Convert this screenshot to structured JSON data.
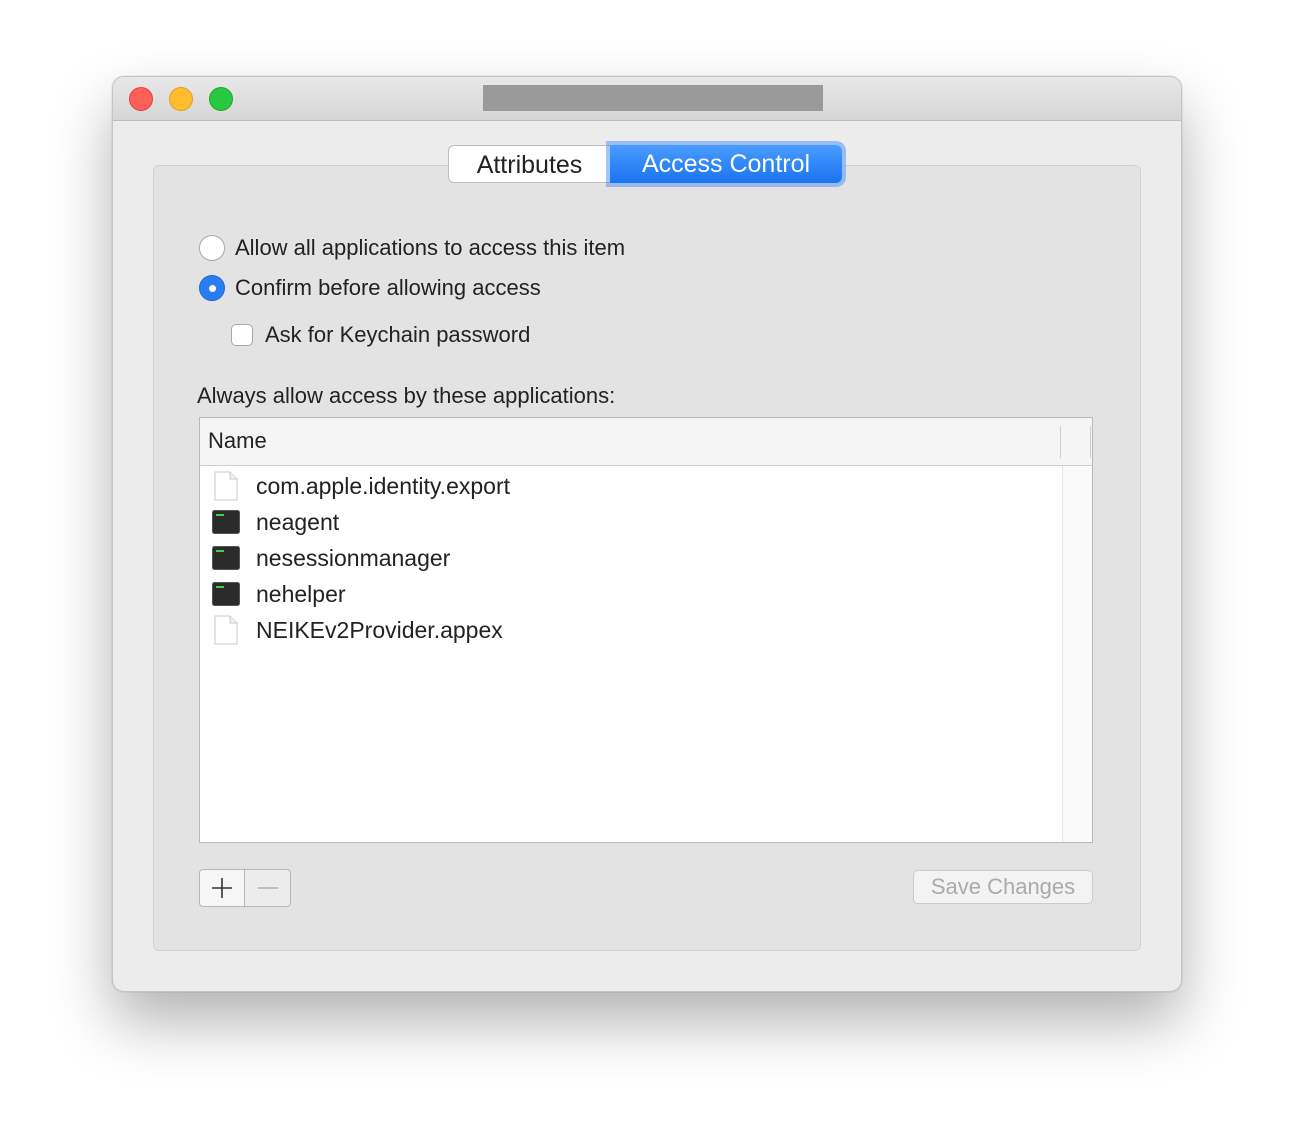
{
  "window": {
    "tabs": [
      {
        "label": "Attributes",
        "selected": false
      },
      {
        "label": "Access Control",
        "selected": true
      }
    ],
    "accent_color": "#2a7cf5"
  },
  "access": {
    "radio_all": {
      "label": "Allow all applications to access this item",
      "selected": false
    },
    "radio_confirm": {
      "label": "Confirm before allowing access",
      "selected": true
    },
    "ask_password": {
      "label": "Ask for Keychain password",
      "checked": false
    }
  },
  "apps": {
    "section_label": "Always allow access by these applications:",
    "column_header": "Name",
    "rows": [
      {
        "name": "com.apple.identity.export",
        "icon": "document-icon"
      },
      {
        "name": "neagent",
        "icon": "terminal-icon"
      },
      {
        "name": "nesessionmanager",
        "icon": "terminal-icon"
      },
      {
        "name": "nehelper",
        "icon": "terminal-icon"
      },
      {
        "name": "NEIKEv2Provider.appex",
        "icon": "document-icon"
      }
    ]
  },
  "footer": {
    "save_label": "Save Changes"
  }
}
